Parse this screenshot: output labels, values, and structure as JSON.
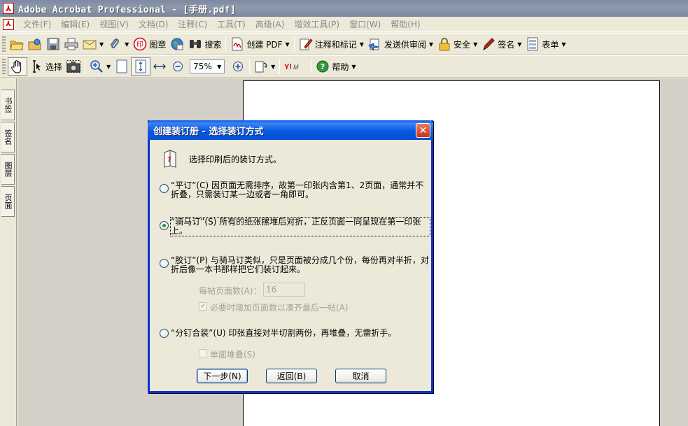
{
  "window": {
    "title": "Adobe Acrobat Professional - [手册.pdf]"
  },
  "menu": [
    "文件(F)",
    "编辑(E)",
    "视图(V)",
    "文档(D)",
    "注释(C)",
    "工具(T)",
    "高级(A)",
    "增效工具(P)",
    "窗口(W)",
    "帮助(H)"
  ],
  "toolbar1": {
    "stamp": "图章",
    "search": "搜索",
    "create_pdf": "创建 PDF",
    "comment_markup": "注释和标记",
    "send_review": "发送供审阅",
    "security": "安全",
    "sign": "签名",
    "forms": "表单"
  },
  "toolbar2": {
    "select": "选择",
    "zoom": "75%",
    "help": "帮助"
  },
  "navpanel": {
    "tabs": [
      "书签",
      "签名",
      "图层",
      "页面"
    ]
  },
  "dialog": {
    "title": "创建装订册 - 选择装订方式",
    "prompt": "选择印刷后的装订方式。",
    "options": [
      {
        "label": "“平订”(C) 因页面无需排序，故第一印张内含第1、2页面，通常并不折叠，只需装订某一边或者一角即可。",
        "selected": false
      },
      {
        "label": "“骑马订”(S) 所有的纸张摞堆后对折，正反页面一同呈现在第一印张上。",
        "selected": true
      },
      {
        "label": "“胶订”(P) 与骑马订类似，只是页面被分成几个份，每份再对半折，对折后像一本书那样把它们装订起来。",
        "selected": false
      },
      {
        "label": "“分钉合装”(U) 印张直接对半切割两份，再堆叠，无需折手。",
        "selected": false
      }
    ],
    "pages_per_signature_label": "每帖页面数(A)：",
    "pages_per_signature_value": "16",
    "add_pages_checkbox": "必要时增加页面数以凑齐最后一帖(A)",
    "add_pages_checked": true,
    "single_stack_checkbox": "单面堆叠(S)",
    "single_stack_checked": false,
    "buttons": {
      "next": "下一步(N)",
      "back": "返回(B)",
      "cancel": "取消"
    }
  }
}
